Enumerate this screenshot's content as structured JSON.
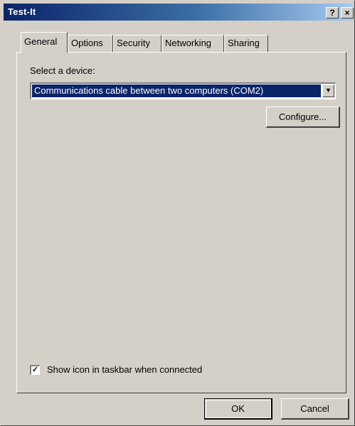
{
  "window": {
    "title": "Test-It",
    "help_glyph": "?",
    "close_glyph": "×"
  },
  "tabs": [
    {
      "label": "General",
      "active": true
    },
    {
      "label": "Options",
      "active": false
    },
    {
      "label": "Security",
      "active": false
    },
    {
      "label": "Networking",
      "active": false
    },
    {
      "label": "Sharing",
      "active": false
    }
  ],
  "general": {
    "device_label": "Select a device:",
    "device_value": "Communications cable between two computers (COM2)",
    "dropdown_arrow": "▼",
    "configure_label": "Configure...",
    "show_icon_checked": true,
    "checkbox_mark": "✓",
    "show_icon_label": "Show icon in taskbar when connected"
  },
  "footer": {
    "ok_label": "OK",
    "cancel_label": "Cancel"
  },
  "colors": {
    "titlebar_start": "#0a246a",
    "titlebar_end": "#a6caf0",
    "dialog_face": "#d4d0c8",
    "selection": "#0a246a"
  }
}
